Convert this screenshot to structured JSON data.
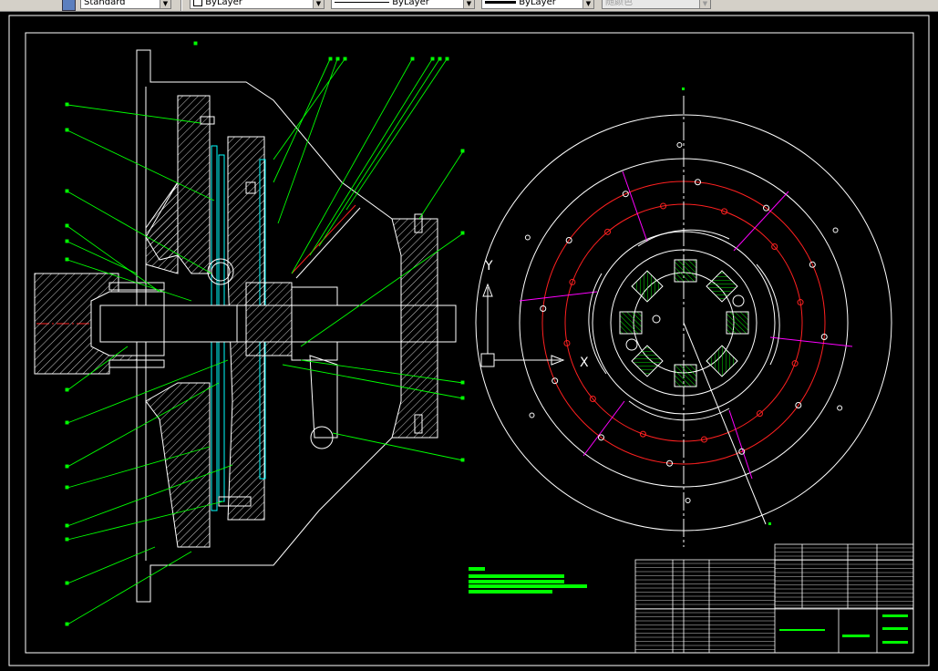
{
  "toolbar": {
    "textstyle_value": "Standard",
    "layer_value": "ByLayer",
    "linetype_value": "ByLayer",
    "lineweight_value": "ByLayer",
    "plotstyle_value": "随颜色"
  },
  "colors": {
    "background": "#000000",
    "drawing_line": "#ffffff",
    "leader": "#00ff00",
    "centerline": "#ff2020",
    "hatch": "#ffffff",
    "cyan_part": "#00ffff",
    "magenta_line": "#ff00ff",
    "spring": "#00ff00"
  },
  "icons": [
    "textstyle-icon",
    "layer-color-swatch-icon",
    "dropdown-arrow-icon",
    "ucs-icon",
    "y-axis-icon",
    "x-axis-icon"
  ]
}
